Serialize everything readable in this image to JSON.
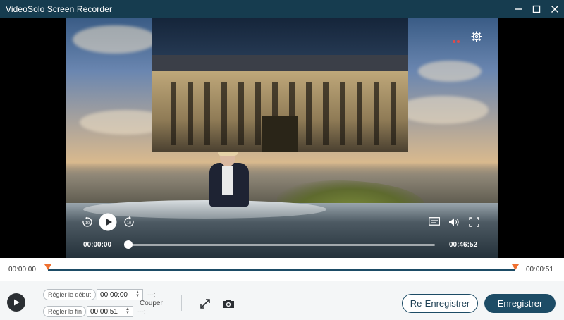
{
  "window": {
    "title": "VideoSolo Screen Recorder",
    "controls": [
      "minimize-icon",
      "maximize-icon",
      "close-icon"
    ]
  },
  "player": {
    "current_time": "00:00:00",
    "duration": "00:46:52",
    "progress": 0,
    "icons": [
      "rewind-10-icon",
      "play-icon",
      "forward-10-icon",
      "subtitles-icon",
      "volume-icon",
      "fullscreen-icon",
      "settings-gear-icon"
    ]
  },
  "trim": {
    "start_time": "00:00:00",
    "end_time": "00:00:51",
    "start_handle_position": 0,
    "end_handle_position": 1
  },
  "controls": {
    "set_start_label": "Régler le début",
    "set_start_value": "00:00:00",
    "set_end_label": "Régler la fin",
    "set_end_value": "00:00:51",
    "dash_top": "---:",
    "dash_bottom": "---:",
    "cut_label": "Couper",
    "rerecord_label": "Re-Enregistrer",
    "record_label": "Enregistrer"
  },
  "colors": {
    "titlebar": "#163c4f",
    "accent": "#1d4c66",
    "trim_handle": "#f07030"
  }
}
